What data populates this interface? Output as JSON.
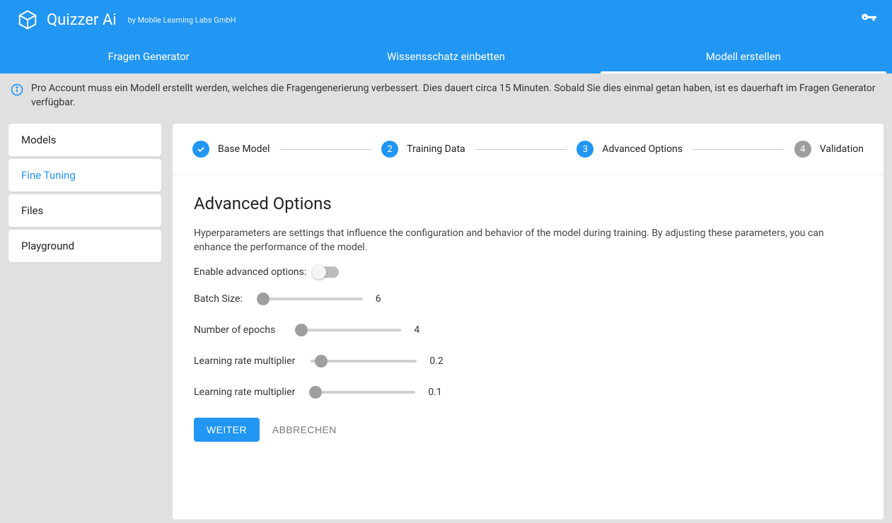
{
  "header": {
    "title": "Quizzer Ai",
    "subtitle": "by Mobile Learning Labs GmbH"
  },
  "tabs": [
    "Fragen Generator",
    "Wissensschatz einbetten",
    "Modell erstellen"
  ],
  "info_text": "Pro Account muss ein Modell erstellt werden, welches die Fragengenerierung verbessert. Dies dauert circa 15 Minuten. Sobald Sie dies einmal getan haben, ist es dauerhaft im Fragen Generator verfügbar.",
  "sidebar": {
    "items": [
      "Models",
      "Fine Tuning",
      "Files",
      "Playground"
    ]
  },
  "stepper": [
    {
      "label": "Base Model",
      "state": "done"
    },
    {
      "num": "2",
      "label": "Training Data",
      "state": "active"
    },
    {
      "num": "3",
      "label": "Advanced Options",
      "state": "active"
    },
    {
      "num": "4",
      "label": "Validation",
      "state": "pending"
    }
  ],
  "section": {
    "title": "Advanced Options",
    "desc": "Hyperparameters are settings that influence the configuration and behavior of the model during training. By adjusting these parameters, you can enhance the performance of the model.",
    "toggle_label": "Enable advanced options:"
  },
  "sliders": [
    {
      "label": "Batch Size:",
      "value": "6",
      "pos": 6
    },
    {
      "label": "Number of epochs",
      "value": "4",
      "pos": 6
    },
    {
      "label": "Learning rate multiplier",
      "value": "0.2",
      "pos": 10
    },
    {
      "label": "Learning rate multiplier",
      "value": "0.1",
      "pos": 6
    }
  ],
  "actions": {
    "primary": "WEITER",
    "secondary": "ABBRECHEN"
  }
}
